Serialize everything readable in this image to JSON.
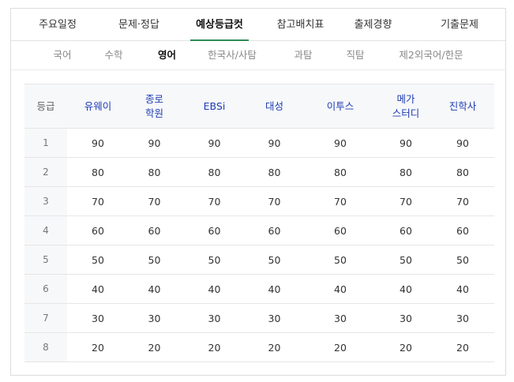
{
  "main_tabs": [
    {
      "label": "주요일정"
    },
    {
      "label": "문제·정답"
    },
    {
      "label": "예상등급컷"
    },
    {
      "label": "참고배치표"
    },
    {
      "label": "출제경향"
    },
    {
      "label": "기출문제"
    }
  ],
  "active_main_tab": "예상등급컷",
  "sub_tabs": [
    {
      "label": "국어"
    },
    {
      "label": "수학"
    },
    {
      "label": "영어"
    },
    {
      "label": "한국사/사탐"
    },
    {
      "label": "과탐"
    },
    {
      "label": "직탐"
    },
    {
      "label": "제2외국어/한문"
    }
  ],
  "active_sub_tab": "영어",
  "table": {
    "header_grade": "등급",
    "columns": [
      {
        "line1": "유웨이",
        "line2": ""
      },
      {
        "line1": "종로",
        "line2": "학원"
      },
      {
        "line1": "EBSi",
        "line2": ""
      },
      {
        "line1": "대성",
        "line2": ""
      },
      {
        "line1": "이투스",
        "line2": ""
      },
      {
        "line1": "메가",
        "line2": "스터디"
      },
      {
        "line1": "진학사",
        "line2": ""
      }
    ],
    "rows": [
      {
        "grade": "1",
        "values": [
          "90",
          "90",
          "90",
          "90",
          "90",
          "90",
          "90"
        ]
      },
      {
        "grade": "2",
        "values": [
          "80",
          "80",
          "80",
          "80",
          "80",
          "80",
          "80"
        ]
      },
      {
        "grade": "3",
        "values": [
          "70",
          "70",
          "70",
          "70",
          "70",
          "70",
          "70"
        ]
      },
      {
        "grade": "4",
        "values": [
          "60",
          "60",
          "60",
          "60",
          "60",
          "60",
          "60"
        ]
      },
      {
        "grade": "5",
        "values": [
          "50",
          "50",
          "50",
          "50",
          "50",
          "50",
          "50"
        ]
      },
      {
        "grade": "6",
        "values": [
          "40",
          "40",
          "40",
          "40",
          "40",
          "40",
          "40"
        ]
      },
      {
        "grade": "7",
        "values": [
          "30",
          "30",
          "30",
          "30",
          "30",
          "30",
          "30"
        ]
      },
      {
        "grade": "8",
        "values": [
          "20",
          "20",
          "20",
          "20",
          "20",
          "20",
          "20"
        ]
      }
    ]
  },
  "colors": {
    "active_underline": "#2e8b57",
    "header_text": "#1d3bb3",
    "header_bg": "#f7f8fa",
    "border": "#e5e5e5"
  }
}
